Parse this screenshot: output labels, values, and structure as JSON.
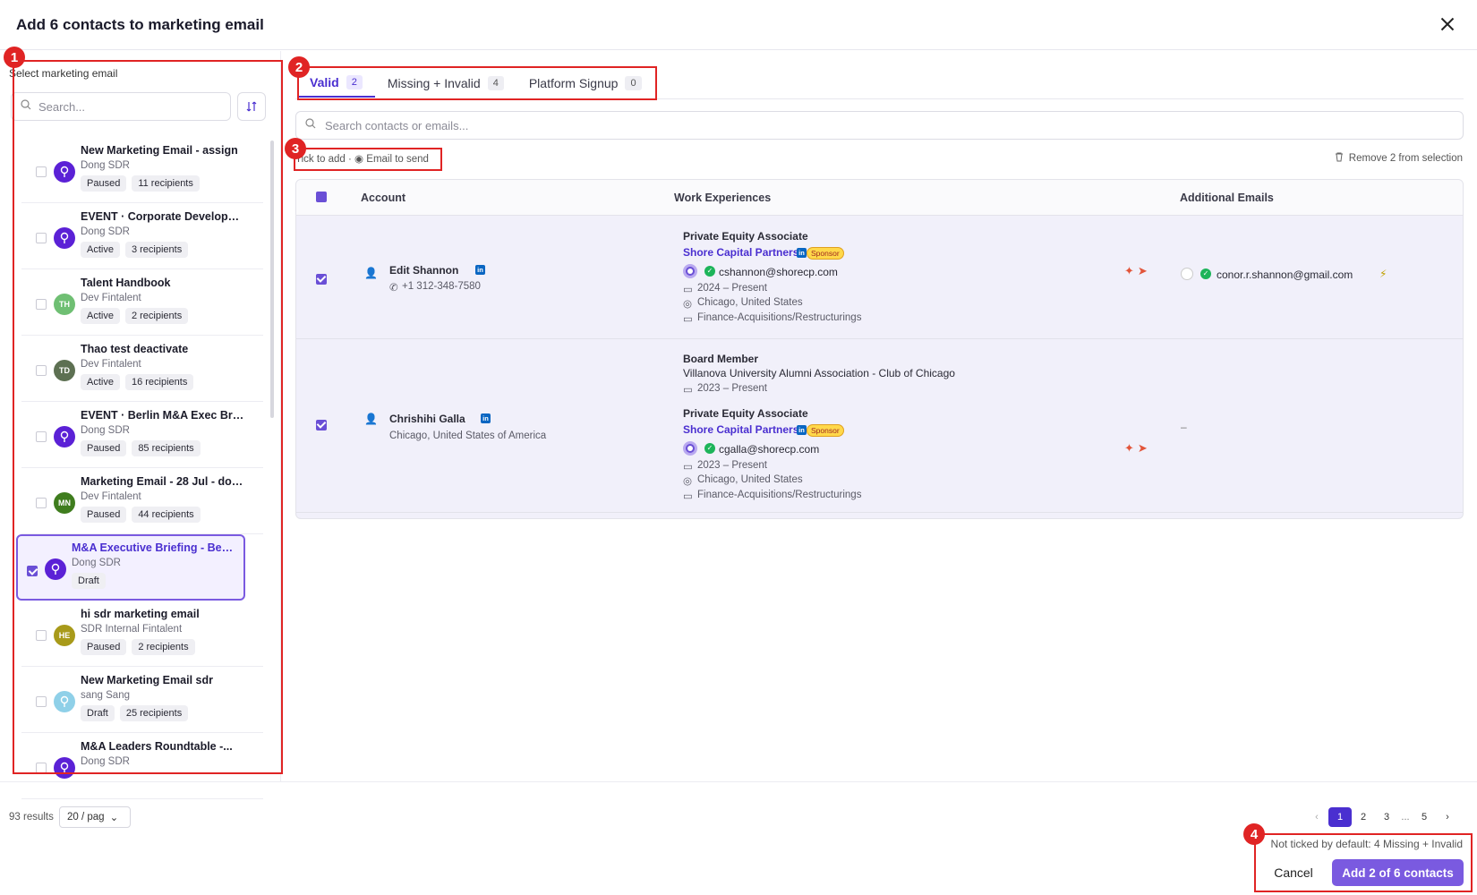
{
  "modal": {
    "title": "Add 6 contacts to marketing email"
  },
  "left": {
    "label": "Select marketing email",
    "search_placeholder": "Search...",
    "emails": [
      {
        "title": "New Marketing Email - assign",
        "owner": "Dong SDR",
        "status": "Paused",
        "recipients": "11 recipients",
        "avatar": "",
        "avatar_color": "#5b21d6",
        "checked": false
      },
      {
        "title": "EVENT · Corporate Development...",
        "owner": "Dong SDR",
        "status": "Active",
        "recipients": "3 recipients",
        "avatar": "",
        "avatar_color": "#5b21d6",
        "checked": false
      },
      {
        "title": "Talent Handbook",
        "owner": "Dev Fintalent",
        "status": "Active",
        "recipients": "2 recipients",
        "avatar": "TH",
        "avatar_color": "#6fbf73",
        "checked": false
      },
      {
        "title": "Thao test deactivate",
        "owner": "Dev Fintalent",
        "status": "Active",
        "recipients": "16 recipients",
        "avatar": "TD",
        "avatar_color": "#5d7052",
        "checked": false
      },
      {
        "title": "EVENT · Berlin M&A Exec Briefi...",
        "owner": "Dong SDR",
        "status": "Paused",
        "recipients": "85 recipients",
        "avatar": "",
        "avatar_color": "#5b21d6",
        "checked": false
      },
      {
        "title": "Marketing Email - 28 Jul - don't...",
        "owner": "Dev Fintalent",
        "status": "Paused",
        "recipients": "44 recipients",
        "avatar": "MN",
        "avatar_color": "#3f7d1e",
        "checked": false
      },
      {
        "title": "M&A Executive Briefing - Berli...",
        "owner": "Dong SDR",
        "status": "Draft",
        "recipients": "",
        "avatar": "",
        "avatar_color": "#5b21d6",
        "checked": true
      },
      {
        "title": "hi sdr marketing email",
        "owner": "SDR Internal Fintalent",
        "status": "Paused",
        "recipients": "2 recipients",
        "avatar": "HE",
        "avatar_color": "#a89a1a",
        "checked": false
      },
      {
        "title": "New Marketing Email sdr",
        "owner": "sang Sang",
        "status": "Draft",
        "recipients": "25 recipients",
        "avatar": "",
        "avatar_color": "#8fd0e8",
        "checked": false
      },
      {
        "title": "M&A Leaders Roundtable -...",
        "owner": "Dong SDR",
        "status": "",
        "recipients": "",
        "avatar": "",
        "avatar_color": "#5b21d6",
        "checked": false
      }
    ],
    "results": "93 results",
    "page_size": "20 / pag"
  },
  "tabs": [
    {
      "label": "Valid",
      "count": "2"
    },
    {
      "label": "Missing + Invalid",
      "count": "4"
    },
    {
      "label": "Platform Signup",
      "count": "0"
    }
  ],
  "contact_search_placeholder": "Search contacts or emails...",
  "hint": "Tick to add · ◉ Email to send",
  "remove": "Remove 2 from selection",
  "table": {
    "headers": {
      "account": "Account",
      "work": "Work Experiences",
      "additional": "Additional Emails"
    },
    "rows": [
      {
        "name": "Edit Shannon",
        "sub": "+1 312-348-7580",
        "jobs": [
          {
            "title": "Private Equity Associate",
            "company": "Shore Capital Partners",
            "sponsor": "Sponsor",
            "email": "cshannon@shorecp.com",
            "dates": "2024 – Present",
            "location": "Chicago, United States",
            "dept": "Finance-Acquisitions/Restructurings"
          }
        ],
        "additional": "conor.r.shannon@gmail.com"
      },
      {
        "name": "Chrishihi Galla",
        "sub": "Chicago, United States of America",
        "board": {
          "title": "Board Member",
          "org": "Villanova University Alumni Association - Club of Chicago",
          "dates": "2023 – Present"
        },
        "jobs": [
          {
            "title": "Private Equity Associate",
            "company": "Shore Capital Partners",
            "sponsor": "Sponsor",
            "email": "cgalla@shorecp.com",
            "dates": "2023 – Present",
            "location": "Chicago, United States",
            "dept": "Finance-Acquisitions/Restructurings"
          }
        ],
        "additional": "–"
      }
    ]
  },
  "pager": {
    "pages": [
      "1",
      "2",
      "3",
      "5"
    ],
    "ellipsis": "...",
    "prev": "‹",
    "next": "›"
  },
  "footer": {
    "note": "Not ticked by default: 4 Missing + Invalid",
    "cancel": "Cancel",
    "add": "Add 2 of 6 contacts"
  },
  "annotations": [
    "1",
    "2",
    "3",
    "4"
  ],
  "colors": {
    "accent": "#4a2fd0",
    "button": "#7a5ae0",
    "annotation": "#e02424"
  }
}
